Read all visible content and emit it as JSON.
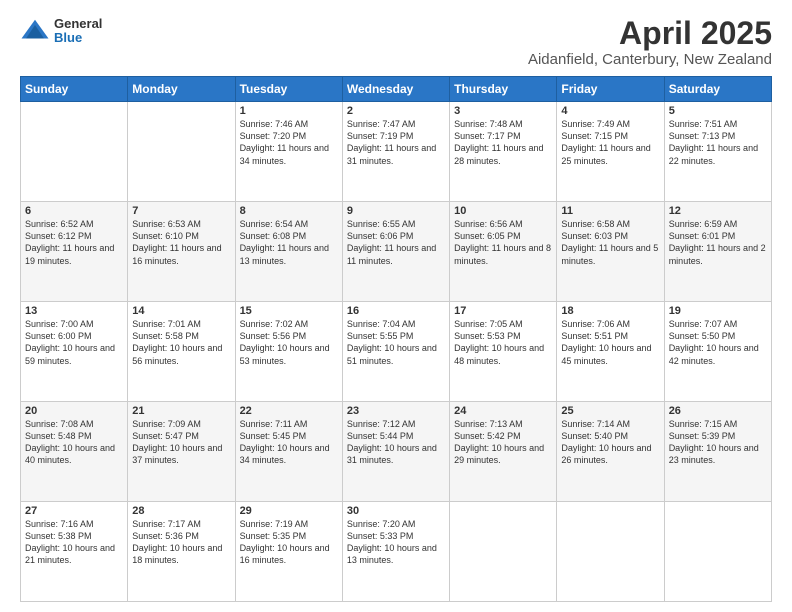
{
  "logo": {
    "general": "General",
    "blue": "Blue"
  },
  "title": "April 2025",
  "subtitle": "Aidanfield, Canterbury, New Zealand",
  "days_of_week": [
    "Sunday",
    "Monday",
    "Tuesday",
    "Wednesday",
    "Thursday",
    "Friday",
    "Saturday"
  ],
  "weeks": [
    [
      {
        "day": "",
        "info": ""
      },
      {
        "day": "",
        "info": ""
      },
      {
        "day": "1",
        "info": "Sunrise: 7:46 AM\nSunset: 7:20 PM\nDaylight: 11 hours and 34 minutes."
      },
      {
        "day": "2",
        "info": "Sunrise: 7:47 AM\nSunset: 7:19 PM\nDaylight: 11 hours and 31 minutes."
      },
      {
        "day": "3",
        "info": "Sunrise: 7:48 AM\nSunset: 7:17 PM\nDaylight: 11 hours and 28 minutes."
      },
      {
        "day": "4",
        "info": "Sunrise: 7:49 AM\nSunset: 7:15 PM\nDaylight: 11 hours and 25 minutes."
      },
      {
        "day": "5",
        "info": "Sunrise: 7:51 AM\nSunset: 7:13 PM\nDaylight: 11 hours and 22 minutes."
      }
    ],
    [
      {
        "day": "6",
        "info": "Sunrise: 6:52 AM\nSunset: 6:12 PM\nDaylight: 11 hours and 19 minutes."
      },
      {
        "day": "7",
        "info": "Sunrise: 6:53 AM\nSunset: 6:10 PM\nDaylight: 11 hours and 16 minutes."
      },
      {
        "day": "8",
        "info": "Sunrise: 6:54 AM\nSunset: 6:08 PM\nDaylight: 11 hours and 13 minutes."
      },
      {
        "day": "9",
        "info": "Sunrise: 6:55 AM\nSunset: 6:06 PM\nDaylight: 11 hours and 11 minutes."
      },
      {
        "day": "10",
        "info": "Sunrise: 6:56 AM\nSunset: 6:05 PM\nDaylight: 11 hours and 8 minutes."
      },
      {
        "day": "11",
        "info": "Sunrise: 6:58 AM\nSunset: 6:03 PM\nDaylight: 11 hours and 5 minutes."
      },
      {
        "day": "12",
        "info": "Sunrise: 6:59 AM\nSunset: 6:01 PM\nDaylight: 11 hours and 2 minutes."
      }
    ],
    [
      {
        "day": "13",
        "info": "Sunrise: 7:00 AM\nSunset: 6:00 PM\nDaylight: 10 hours and 59 minutes."
      },
      {
        "day": "14",
        "info": "Sunrise: 7:01 AM\nSunset: 5:58 PM\nDaylight: 10 hours and 56 minutes."
      },
      {
        "day": "15",
        "info": "Sunrise: 7:02 AM\nSunset: 5:56 PM\nDaylight: 10 hours and 53 minutes."
      },
      {
        "day": "16",
        "info": "Sunrise: 7:04 AM\nSunset: 5:55 PM\nDaylight: 10 hours and 51 minutes."
      },
      {
        "day": "17",
        "info": "Sunrise: 7:05 AM\nSunset: 5:53 PM\nDaylight: 10 hours and 48 minutes."
      },
      {
        "day": "18",
        "info": "Sunrise: 7:06 AM\nSunset: 5:51 PM\nDaylight: 10 hours and 45 minutes."
      },
      {
        "day": "19",
        "info": "Sunrise: 7:07 AM\nSunset: 5:50 PM\nDaylight: 10 hours and 42 minutes."
      }
    ],
    [
      {
        "day": "20",
        "info": "Sunrise: 7:08 AM\nSunset: 5:48 PM\nDaylight: 10 hours and 40 minutes."
      },
      {
        "day": "21",
        "info": "Sunrise: 7:09 AM\nSunset: 5:47 PM\nDaylight: 10 hours and 37 minutes."
      },
      {
        "day": "22",
        "info": "Sunrise: 7:11 AM\nSunset: 5:45 PM\nDaylight: 10 hours and 34 minutes."
      },
      {
        "day": "23",
        "info": "Sunrise: 7:12 AM\nSunset: 5:44 PM\nDaylight: 10 hours and 31 minutes."
      },
      {
        "day": "24",
        "info": "Sunrise: 7:13 AM\nSunset: 5:42 PM\nDaylight: 10 hours and 29 minutes."
      },
      {
        "day": "25",
        "info": "Sunrise: 7:14 AM\nSunset: 5:40 PM\nDaylight: 10 hours and 26 minutes."
      },
      {
        "day": "26",
        "info": "Sunrise: 7:15 AM\nSunset: 5:39 PM\nDaylight: 10 hours and 23 minutes."
      }
    ],
    [
      {
        "day": "27",
        "info": "Sunrise: 7:16 AM\nSunset: 5:38 PM\nDaylight: 10 hours and 21 minutes."
      },
      {
        "day": "28",
        "info": "Sunrise: 7:17 AM\nSunset: 5:36 PM\nDaylight: 10 hours and 18 minutes."
      },
      {
        "day": "29",
        "info": "Sunrise: 7:19 AM\nSunset: 5:35 PM\nDaylight: 10 hours and 16 minutes."
      },
      {
        "day": "30",
        "info": "Sunrise: 7:20 AM\nSunset: 5:33 PM\nDaylight: 10 hours and 13 minutes."
      },
      {
        "day": "",
        "info": ""
      },
      {
        "day": "",
        "info": ""
      },
      {
        "day": "",
        "info": ""
      }
    ]
  ]
}
